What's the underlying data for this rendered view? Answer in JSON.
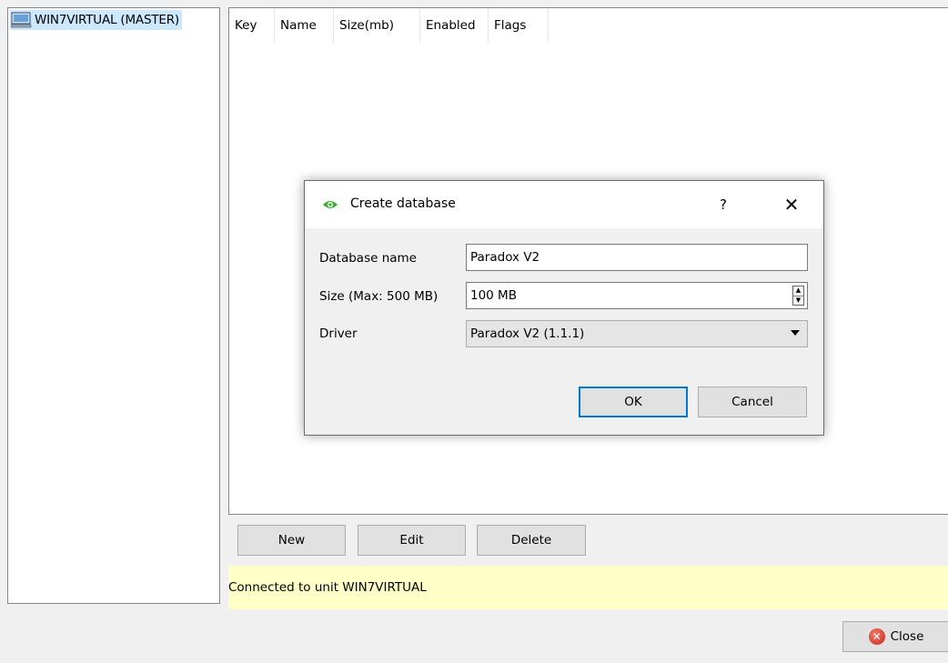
{
  "tree": {
    "root_label": "WIN7VIRTUAL (MASTER)"
  },
  "table": {
    "columns": [
      "Key",
      "Name",
      "Size(mb)",
      "Enabled",
      "Flags"
    ]
  },
  "buttons": {
    "new_label": "New",
    "edit_label": "Edit",
    "delete_label": "Delete",
    "close_label": "Close"
  },
  "status": {
    "text": "Connected to unit WIN7VIRTUAL"
  },
  "dialog": {
    "title": "Create database",
    "help_label": "?",
    "close_label": "✕",
    "name_label": "Database name",
    "name_value": "Paradox V2",
    "size_label": "Size (Max: 500 MB)",
    "size_value": "100 MB",
    "driver_label": "Driver",
    "driver_value": "Paradox V2 (1.1.1)",
    "ok_label": "OK",
    "cancel_label": "Cancel"
  },
  "colors": {
    "status_bg": "#ffffc8",
    "selection_bg": "#cce8ff",
    "ok_border": "#0078d7",
    "eye_icon": "#3cb034"
  },
  "icons": {
    "tree_item": "computer-icon",
    "dialog": "eye-icon",
    "close_button": "close-circle-icon"
  }
}
